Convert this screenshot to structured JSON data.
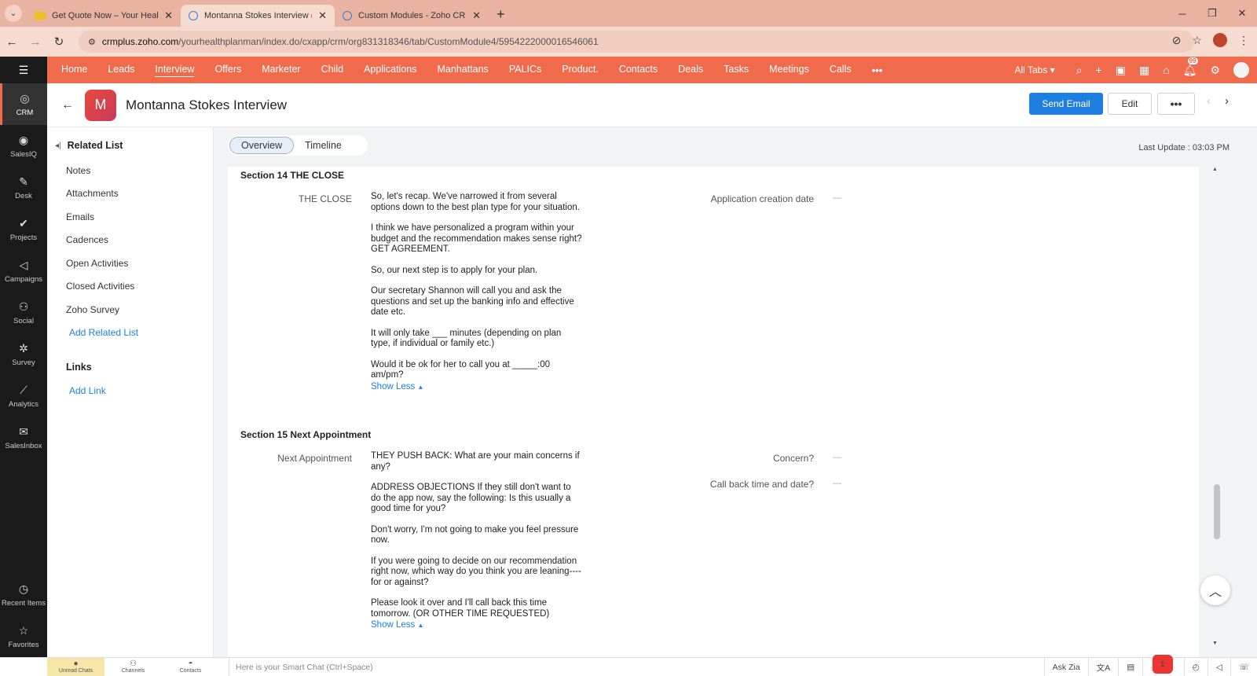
{
  "browser": {
    "tabs": [
      {
        "title": "Get Quote Now – Your Health P",
        "active": false
      },
      {
        "title": "Montanna Stokes Interview (Int",
        "active": true
      },
      {
        "title": "Custom Modules - Zoho CRM",
        "active": false
      }
    ],
    "url_host": "crmplus.zoho.com",
    "url_path": "/yourhealthplanman/index.do/cxapp/crm/org831318346/tab/CustomModule4/5954222000016546061"
  },
  "topnav": {
    "items": [
      "Home",
      "Leads",
      "Interview",
      "Offers",
      "Marketer",
      "Child",
      "Applications",
      "Manhattans",
      "PALICs",
      "Product.",
      "Contacts",
      "Deals",
      "Tasks",
      "Meetings",
      "Calls"
    ],
    "active": "Interview",
    "all_tabs": "All Tabs",
    "notification_count": "99"
  },
  "appsidebar": {
    "items": [
      "CRM",
      "SalesIQ",
      "Desk",
      "Projects",
      "Campaigns",
      "Social",
      "Survey",
      "Analytics",
      "SalesInbox"
    ],
    "bottom": [
      "Recent Items",
      "Favorites"
    ]
  },
  "record": {
    "avatar_letter": "M",
    "title": "Montanna Stokes Interview",
    "send_email": "Send Email",
    "edit": "Edit"
  },
  "related": {
    "heading": "Related List",
    "items": [
      "Notes",
      "Attachments",
      "Emails",
      "Cadences",
      "Open Activities",
      "Closed Activities",
      "Zoho Survey"
    ],
    "add_related": "Add Related List",
    "links_heading": "Links",
    "add_link": "Add Link"
  },
  "content_tabs": {
    "overview": "Overview",
    "timeline": "Timeline",
    "last_update": "Last Update : 03:03 PM"
  },
  "section14": {
    "heading": "Section 14 THE CLOSE",
    "label": "THE CLOSE",
    "paragraphs": [
      "So, let's recap. We've narrowed it from several options down to the best plan type for your situation.",
      "I think we have personalized a program within your budget and the recommendation makes sense right? GET AGREEMENT.",
      "So, our next step is to apply for your plan.",
      "Our secretary Shannon will call you and ask the questions and set up the banking info and effective date etc.",
      "It will only take ___ minutes (depending on plan type, if individual or family etc.)",
      "Would it be ok for her to call you at _____:00 am/pm?"
    ],
    "show_less": "Show Less",
    "right_label": "Application creation date",
    "right_value": "—"
  },
  "section15": {
    "heading": "Section 15 Next Appointment",
    "label": "Next Appointment",
    "paragraphs": [
      "THEY PUSH BACK: What are your main concerns if any?",
      "ADDRESS OBJECTIONS If they still don't want to do the app now, say the following: Is this usually a good time for you?",
      "Don't worry, I'm not going to make you feel pressure now.",
      "If you were going to decide on our recommendation right now, which way do you think you are leaning----for or against?",
      "Please look it over and I'll call back this time tomorrow. (OR OTHER TIME REQUESTED)"
    ],
    "show_less": "Show Less",
    "right_label_1": "Concern?",
    "right_label_2": "Call back time and date?",
    "right_value": "—"
  },
  "bottombar": {
    "items": [
      "Unread Chats",
      "Channels",
      "Contacts"
    ],
    "smartchat": "Here is your Smart Chat (Ctrl+Space)",
    "ask_zia": "Ask Zia",
    "badge": "1"
  }
}
